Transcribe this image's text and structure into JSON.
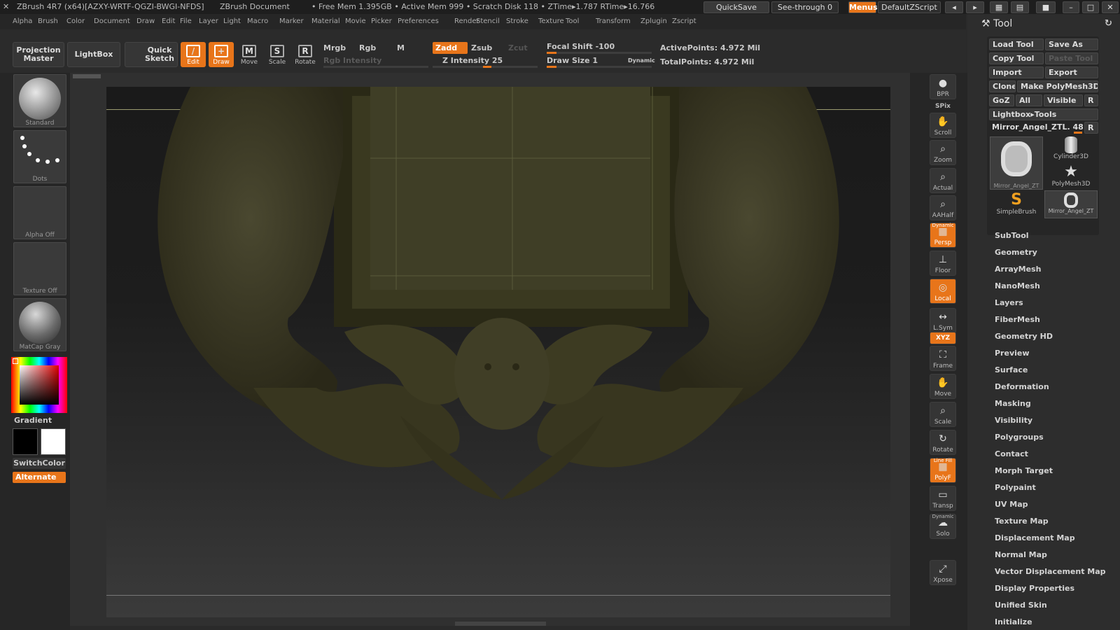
{
  "title_bar": {
    "app_title": "ZBrush 4R7 (x64)[AZXY-WRTF-QGZI-BWGI-NFDS]",
    "document": "ZBrush Document",
    "stats": "• Free Mem 1.395GB • Active Mem 999 • Scratch Disk 118 • ZTime▸1.787 RTime▸16.766",
    "quicksave": "QuickSave",
    "see_through": "See-through  0",
    "menus": "Menus",
    "default_script": "DefaultZScript"
  },
  "menu_bar": [
    "Alpha",
    "Brush",
    "Color",
    "Document",
    "Draw",
    "Edit",
    "File",
    "Layer",
    "Light",
    "Macro",
    "Marker",
    "Material",
    "Movie",
    "Picker",
    "Preferences",
    "Render",
    "Stencil",
    "Stroke",
    "Texture",
    "Tool",
    "Transform",
    "Zplugin",
    "Zscript"
  ],
  "top_shelf": {
    "projection_master": "Projection Master",
    "lightbox": "LightBox",
    "quick_sketch": "Quick Sketch",
    "edit": "Edit",
    "draw": "Draw",
    "move": "Move",
    "scale": "Scale",
    "rotate": "Rotate",
    "mrgb": "Mrgb",
    "rgb": "Rgb",
    "m": "M",
    "rgb_intensity": "Rgb Intensity",
    "zadd": "Zadd",
    "zsub": "Zsub",
    "zcut": "Zcut",
    "z_intensity": "Z Intensity 25",
    "focal_shift": "Focal Shift -100",
    "draw_size": "Draw Size 1",
    "dynamic": "Dynamic",
    "active_points": "ActivePoints: 4.972  Mil",
    "total_points": "TotalPoints: 4.972  Mil"
  },
  "left_shelf": {
    "brush": "Standard",
    "stroke": "Dots",
    "alpha": "Alpha  Off",
    "texture": "Texture  Off",
    "material": "MatCap  Gray",
    "gradient": "Gradient",
    "switch_color": "SwitchColor",
    "alternate": "Alternate"
  },
  "right_shelf": [
    {
      "label": "BPR",
      "icon": "bpr-icon"
    },
    {
      "label": "SPix",
      "icon": "spix-icon"
    },
    {
      "label": "Scroll",
      "icon": "scroll-icon"
    },
    {
      "label": "Zoom",
      "icon": "zoom-icon"
    },
    {
      "label": "Actual",
      "icon": "actual-icon"
    },
    {
      "label": "AAHalf",
      "icon": "aahalf-icon"
    },
    {
      "label": "Persp",
      "icon": "persp-icon",
      "top": "Dynamic"
    },
    {
      "label": "Floor",
      "icon": "floor-icon"
    },
    {
      "label": "Local",
      "icon": "local-icon"
    },
    {
      "label": "L.Sym",
      "icon": "lsym-icon"
    },
    {
      "label": "XYZ",
      "icon": "xyz-icon"
    },
    {
      "label": "Frame",
      "icon": "frame-icon"
    },
    {
      "label": "Move",
      "icon": "move-icon"
    },
    {
      "label": "Scale",
      "icon": "scale-icon"
    },
    {
      "label": "Rotate",
      "icon": "rotate-icon"
    },
    {
      "label": "PolyF",
      "icon": "polyf-icon",
      "top": "Line Fill"
    },
    {
      "label": "Transp",
      "icon": "transp-icon"
    },
    {
      "label": "Solo",
      "icon": "solo-icon",
      "top": "Dynamic"
    },
    {
      "label": "Xpose",
      "icon": "xpose-icon"
    }
  ],
  "tool_panel": {
    "title": "Tool",
    "load_tool": "Load Tool",
    "save_as": "Save As",
    "copy_tool": "Copy Tool",
    "paste_tool": "Paste Tool",
    "import": "Import",
    "export": "Export",
    "clone": "Clone",
    "make_polymesh": "Make PolyMesh3D",
    "goz": "GoZ",
    "all": "All",
    "visible": "Visible",
    "r": "R",
    "lightbox_tools": "Lightbox▸Tools",
    "current_tool": "Mirror_Angel_ZTL. 48",
    "thumbs": [
      "Mirror_Angel_ZT",
      "Cylinder3D",
      "PolyMesh3D",
      "SimpleBrush",
      "Mirror_Angel_ZT"
    ],
    "sections": [
      "SubTool",
      "Geometry",
      "ArrayMesh",
      "NanoMesh",
      "Layers",
      "FiberMesh",
      "Geometry HD",
      "Preview",
      "Surface",
      "Deformation",
      "Masking",
      "Visibility",
      "Polygroups",
      "Contact",
      "Morph Target",
      "Polypaint",
      "UV Map",
      "Texture Map",
      "Displacement Map",
      "Normal Map",
      "Vector Displacement Map",
      "Display Properties",
      "Unified Skin",
      "Initialize"
    ]
  },
  "colors": {
    "accent": "#e8751a",
    "model": "#3e3c24"
  }
}
